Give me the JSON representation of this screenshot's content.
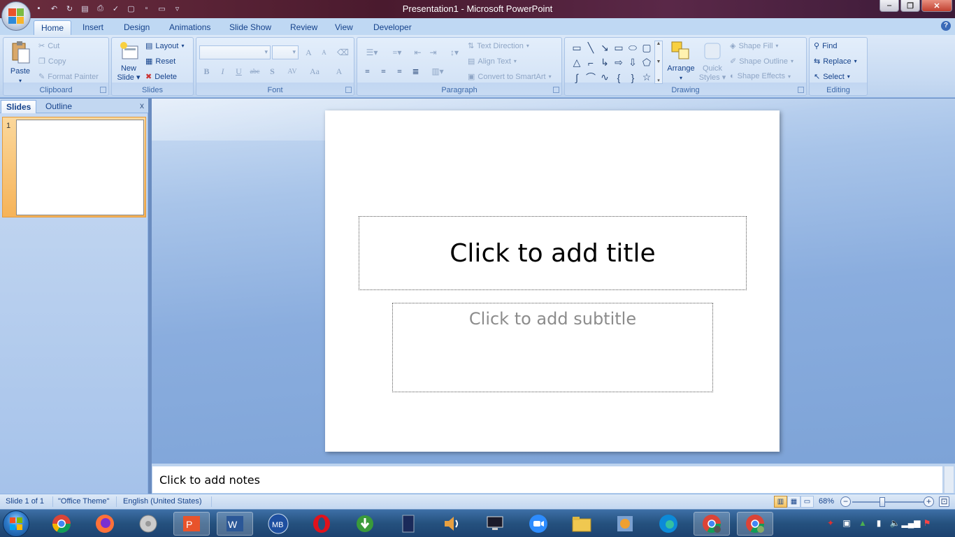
{
  "window": {
    "title": "Presentation1 - Microsoft PowerPoint",
    "controls": {
      "minimize": "‒",
      "maximize": "❐",
      "close": "✕"
    }
  },
  "quick_access": [
    "save-icon",
    "undo-icon",
    "redo-icon",
    "new-slide-icon",
    "print-preview-icon",
    "spelling-icon",
    "quick-print-icon",
    "new-icon",
    "open-icon",
    "customize-icon"
  ],
  "tabs": [
    {
      "label": "Home",
      "active": true
    },
    {
      "label": "Insert"
    },
    {
      "label": "Design"
    },
    {
      "label": "Animations"
    },
    {
      "label": "Slide Show"
    },
    {
      "label": "Review"
    },
    {
      "label": "View"
    },
    {
      "label": "Developer"
    }
  ],
  "ribbon": {
    "clipboard": {
      "label": "Clipboard",
      "paste": "Paste",
      "cut": "Cut",
      "copy": "Copy",
      "format_painter": "Format Painter"
    },
    "slides": {
      "label": "Slides",
      "new_slide_1": "New",
      "new_slide_2": "Slide",
      "layout": "Layout",
      "reset": "Reset",
      "delete": "Delete"
    },
    "font": {
      "label": "Font",
      "bold": "B",
      "italic": "I",
      "underline": "U",
      "strike": "abc",
      "shadow": "S",
      "spacing": "AV",
      "case": "Aa",
      "color": "A",
      "grow": "A",
      "shrink": "A"
    },
    "paragraph": {
      "label": "Paragraph",
      "text_direction": "Text Direction",
      "align_text": "Align Text",
      "convert_smartart": "Convert to SmartArt"
    },
    "drawing": {
      "label": "Drawing",
      "arrange": "Arrange",
      "quick_styles_1": "Quick",
      "quick_styles_2": "Styles",
      "shape_fill": "Shape Fill",
      "shape_outline": "Shape Outline",
      "shape_effects": "Shape Effects"
    },
    "editing": {
      "label": "Editing",
      "find": "Find",
      "replace": "Replace",
      "select": "Select"
    }
  },
  "panel": {
    "tabs": {
      "slides": "Slides",
      "outline": "Outline"
    },
    "close": "x",
    "thumbnail_number": "1"
  },
  "slide": {
    "title_placeholder": "Click to add title",
    "subtitle_placeholder": "Click to add subtitle"
  },
  "notes": {
    "placeholder": "Click to add notes"
  },
  "status": {
    "slide_info": "Slide 1 of 1",
    "theme": "\"Office Theme\"",
    "language": "English (United States)",
    "zoom": "68%",
    "zoom_fraction": 0.68
  },
  "taskbar": {
    "apps": [
      "windows-start-icon",
      "chrome-icon",
      "firefox-icon",
      "media-icon",
      "powerpoint-icon",
      "word-icon",
      "malwarebytes-icon",
      "opera-icon",
      "download-icon",
      "book-icon",
      "speaker-icon",
      "monitor-icon",
      "zoom-icon",
      "folder-icon",
      "photo-icon",
      "edge-icon",
      "chrome-user-icon",
      "chrome-profile-icon"
    ],
    "tray": [
      "acrobat-icon",
      "app-icon",
      "triangle-icon",
      "device-icon",
      "volume-icon",
      "network-icon",
      "flag-icon"
    ]
  },
  "colors": {
    "accent": "#15428b",
    "ribbon_bg": "#c7daf2",
    "selected_thumb": "#f6b358"
  }
}
